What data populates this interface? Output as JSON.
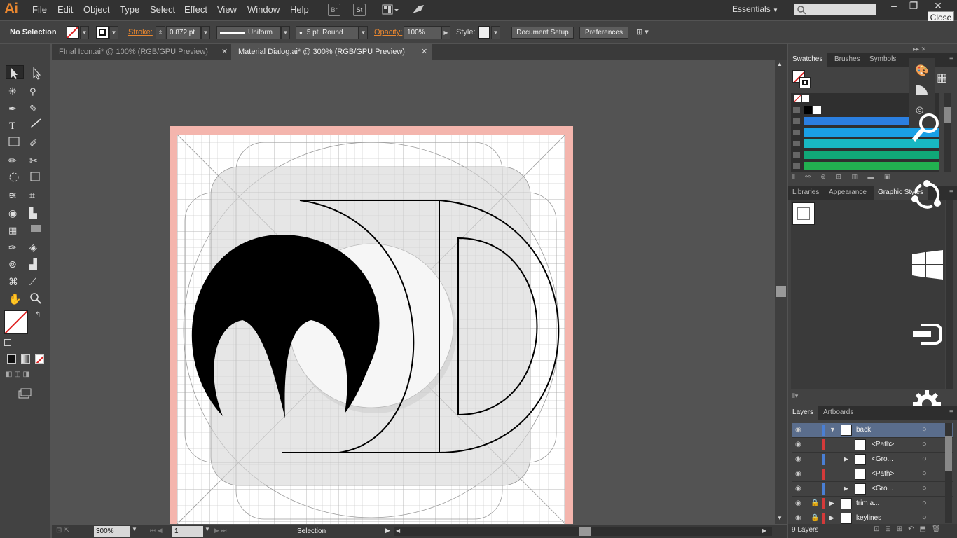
{
  "app": {
    "logo": "Ai"
  },
  "menu": {
    "items": [
      "File",
      "Edit",
      "Object",
      "Type",
      "Select",
      "Effect",
      "View",
      "Window",
      "Help"
    ]
  },
  "topbar": {
    "bridge": "Br",
    "stock": "St",
    "workspace": "Essentials",
    "close_tooltip": "Close"
  },
  "control": {
    "selection": "No Selection",
    "stroke_label": "Stroke:",
    "stroke_value": "0.872 pt",
    "profile": "Uniform",
    "brush": "5 pt. Round",
    "opacity_label": "Opacity:",
    "opacity_value": "100%",
    "style_label": "Style:",
    "doc_setup": "Document Setup",
    "preferences": "Preferences"
  },
  "tabs": [
    {
      "label": "FInal Icon.ai* @ 100% (RGB/GPU Preview)",
      "active": false
    },
    {
      "label": "Material Dialog.ai* @ 300% (RGB/GPU Preview)",
      "active": true
    }
  ],
  "status": {
    "zoom": "300%",
    "artboard": "1",
    "tool": "Selection"
  },
  "panels": {
    "swatches_tabs": [
      "Swatches",
      "Brushes",
      "Symbols"
    ],
    "styles_tabs": [
      "Libraries",
      "Appearance",
      "Graphic Styles"
    ],
    "layers_tabs": [
      "Layers",
      "Artboards"
    ],
    "layers_count": "9 Layers",
    "layers": [
      {
        "name": "back",
        "type": "layer",
        "color": "#4a7fd4"
      },
      {
        "name": "<Path>",
        "type": "item",
        "color": "#d43a3a"
      },
      {
        "name": "<Gro...",
        "type": "item",
        "color": "#4a7fd4"
      },
      {
        "name": "<Path>",
        "type": "item",
        "color": "#d43a3a"
      },
      {
        "name": "<Gro...",
        "type": "item",
        "color": "#4a7fd4"
      },
      {
        "name": "trim a...",
        "type": "layer",
        "color": "#d43a3a"
      },
      {
        "name": "keylines",
        "type": "layer",
        "color": "#d43a3a"
      }
    ]
  },
  "colors": {
    "accent": "#e8862f",
    "artboard_bleed": "#f4b5ad",
    "icon_fill": "#000000"
  }
}
